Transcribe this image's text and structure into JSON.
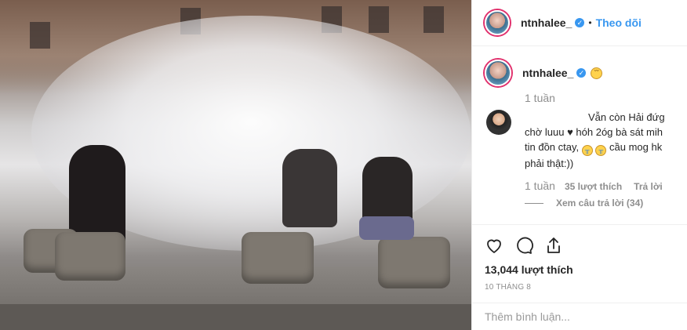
{
  "post": {
    "username": "ntnhalee_",
    "follow_label": "Theo dõi",
    "separator": "•",
    "verified_icon": "verified-badge-icon",
    "caption_emoji": "pensive-face-emoji",
    "time": "1 tuần",
    "likes": "13,044 lượt thích",
    "date": "10 THÁNG 8",
    "add_comment_placeholder": "Thêm bình luận..."
  },
  "comment": {
    "text_line1": "Vẫn còn Hải đứg",
    "text_line2_a": "chờ luuu",
    "text_line2_b": "hóh 2óg bà sát mih",
    "text_line3_a": "tin đồn ctay,",
    "text_line3_b": "cầu mog hk",
    "text_line4": "phải thật:))",
    "heart_icon": "black-heart-emoji",
    "crying_icon": "crying-face-emoji",
    "time": "1 tuần",
    "likes": "35 lượt thích",
    "reply_label": "Trả lời",
    "view_replies": "Xem câu trả lời (34)"
  },
  "photo": {
    "description_icon": "photo-image"
  },
  "colors": {
    "link": "#3897f0",
    "text": "#262626",
    "muted": "#8e8e8e",
    "border": "#efefef"
  }
}
